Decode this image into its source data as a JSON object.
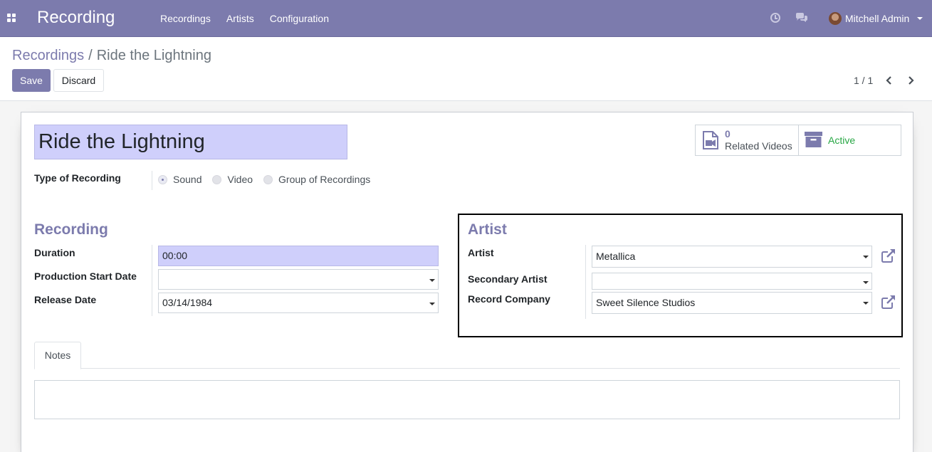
{
  "navbar": {
    "app_name": "Recording",
    "menu": [
      "Recordings",
      "Artists",
      "Configuration"
    ],
    "user_name": "Mitchell Admin"
  },
  "breadcrumb": {
    "parent": "Recordings",
    "separator": "/",
    "current": "Ride the Lightning"
  },
  "actions": {
    "save_label": "Save",
    "discard_label": "Discard"
  },
  "pager": {
    "value": "1 / 1"
  },
  "record": {
    "title": "Ride the Lightning"
  },
  "smart_buttons": {
    "videos_count": "0",
    "videos_label": "Related Videos",
    "active_label": "Active"
  },
  "type_of_recording": {
    "label": "Type of Recording",
    "options": [
      "Sound",
      "Video",
      "Group of Recordings"
    ],
    "selected": "Sound"
  },
  "recording_group": {
    "title": "Recording",
    "duration_label": "Duration",
    "duration_value": "00:00",
    "production_start_label": "Production Start Date",
    "production_start_value": "",
    "release_date_label": "Release Date",
    "release_date_value": "03/14/1984"
  },
  "artist_group": {
    "title": "Artist",
    "artist_label": "Artist",
    "artist_value": "Metallica",
    "secondary_artist_label": "Secondary Artist",
    "secondary_artist_value": "",
    "record_company_label": "Record Company",
    "record_company_value": "Sweet Silence Studios"
  },
  "tabs": [
    "Notes"
  ],
  "colors": {
    "brand": "#7c7bad",
    "field_highlight": "#cfcffb",
    "active_green": "#28a745"
  }
}
